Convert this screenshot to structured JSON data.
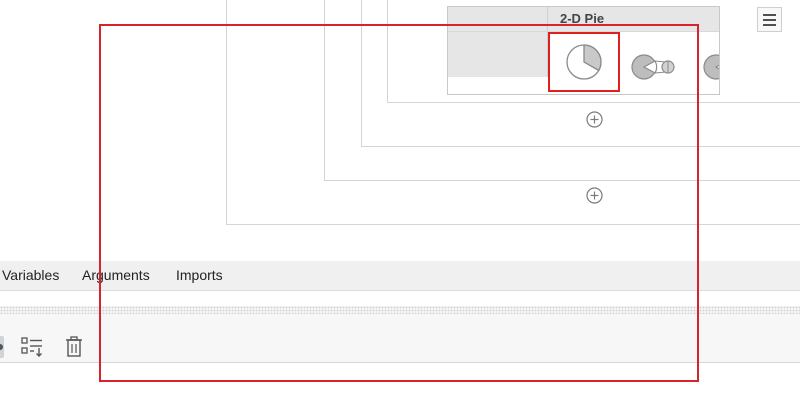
{
  "gallery": {
    "header": "2-D Pie",
    "options": [
      {
        "icon": "pie-chart-icon",
        "selected": true
      },
      {
        "icon": "pie-of-pie-icon",
        "selected": false
      },
      {
        "icon": "bar-of-pie-icon",
        "selected": false
      }
    ]
  },
  "tabs": {
    "variables": "Variables",
    "arguments": "Arguments",
    "imports": "Imports"
  },
  "toolbar": {
    "icons": [
      "sort-list-icon",
      "delete-icon"
    ]
  },
  "colors": {
    "highlight": "#e02020",
    "annotation": "#d9232c",
    "container_border": "#d4d4d4"
  }
}
